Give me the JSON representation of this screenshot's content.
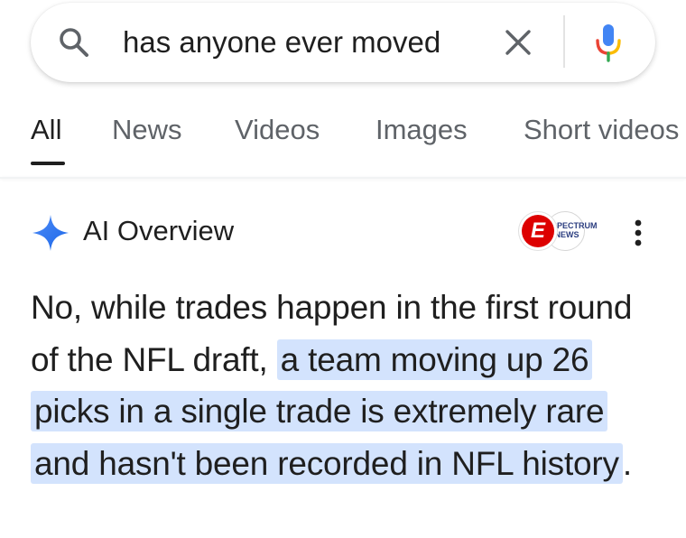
{
  "search": {
    "query": "has anyone ever moved",
    "icon": "search-icon",
    "clear_icon": "close-icon",
    "mic_icon": "microphone-icon"
  },
  "tabs": [
    {
      "label": "All",
      "active": true
    },
    {
      "label": "News",
      "active": false
    },
    {
      "label": "Videos",
      "active": false
    },
    {
      "label": "Images",
      "active": false
    },
    {
      "label": "Short videos",
      "active": false
    }
  ],
  "ai_overview": {
    "title": "AI Overview",
    "icon": "sparkle-icon",
    "sources": [
      {
        "name": "ESPN",
        "badge": "E",
        "color": "#dd0000"
      },
      {
        "name": "Spectrum News",
        "badge": "SPECTRUM NEWS",
        "color": "#2c3e80"
      }
    ],
    "more_icon": "more-vert-icon",
    "answer_plain": "No, while trades happen in the first round of the NFL draft, ",
    "answer_highlight": "a team moving up 26 picks in a single trade is extremely rare and hasn't been recorded in NFL history",
    "answer_end": ".",
    "highlight_color": "#d3e3fd"
  }
}
